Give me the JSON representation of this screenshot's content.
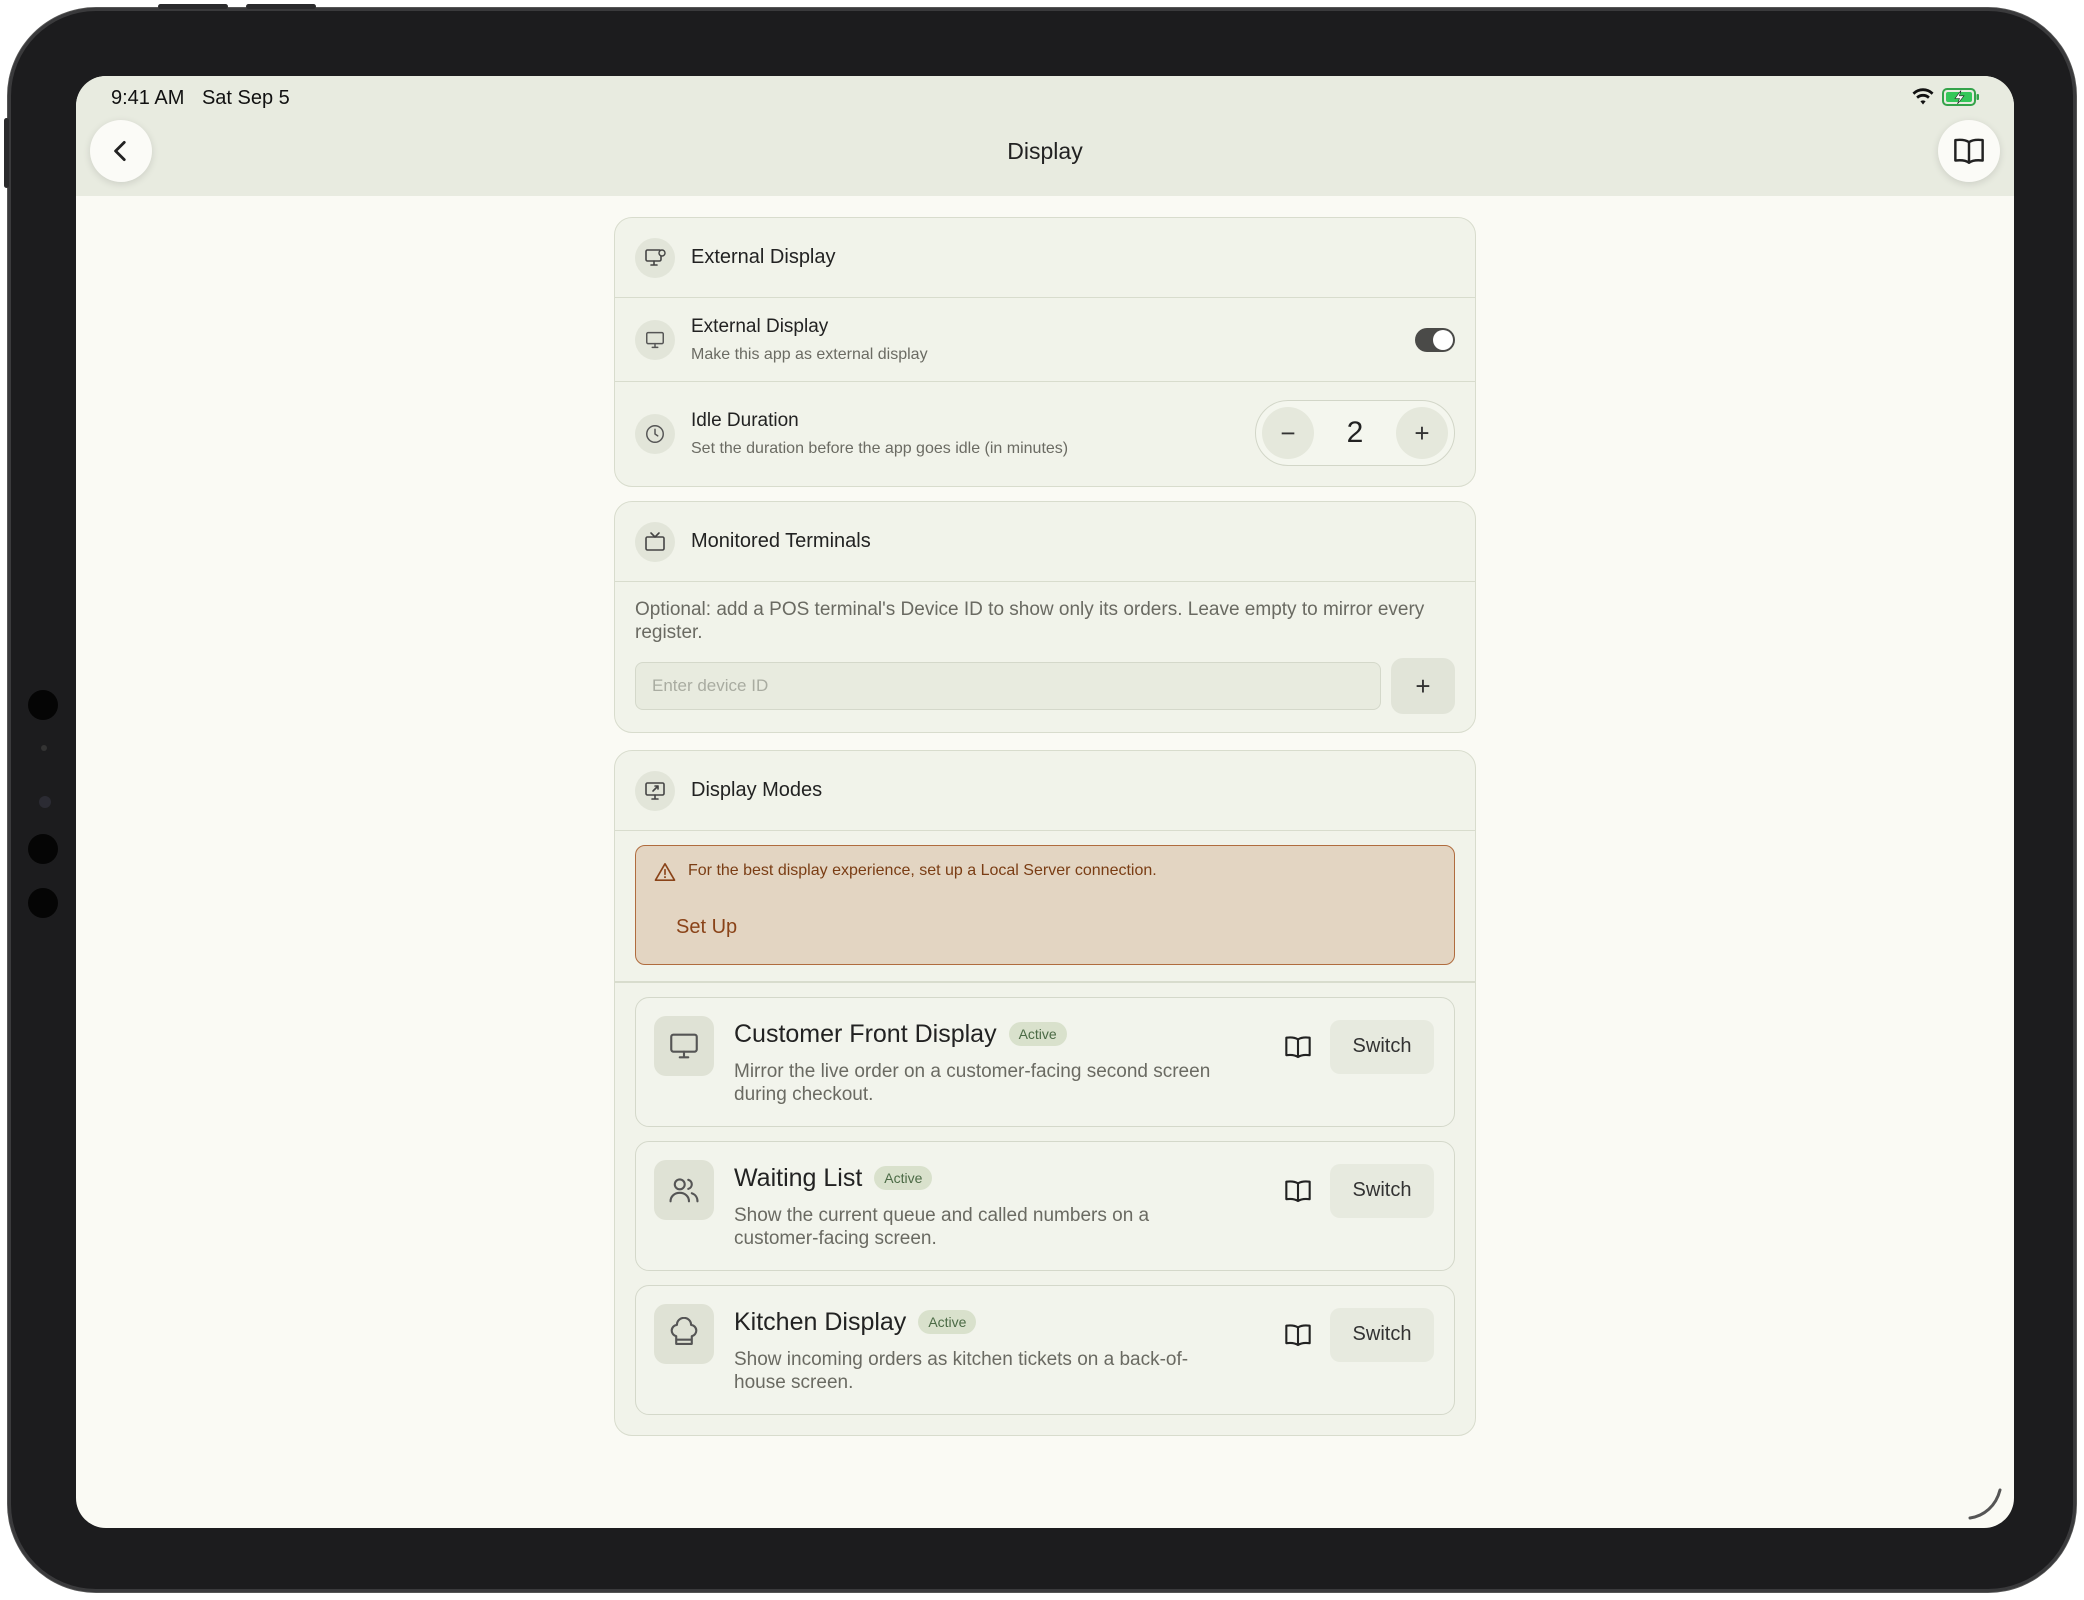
{
  "status": {
    "time": "9:41 AM",
    "date": "Sat Sep 5"
  },
  "header": {
    "title": "Display"
  },
  "external_display": {
    "section_title": "External Display",
    "toggle_row": {
      "title": "External Display",
      "subtitle": "Make this app as external display",
      "on": true
    },
    "idle_row": {
      "title": "Idle Duration",
      "subtitle": "Set the duration before the app goes idle (in minutes)",
      "value": "2",
      "minus": "−",
      "plus": "+"
    }
  },
  "monitored_terminals": {
    "section_title": "Monitored Terminals",
    "note": "Optional: add a POS terminal's Device ID to show only its orders. Leave empty to mirror every register.",
    "input_placeholder": "Enter device ID",
    "input_value": "",
    "add_label": "+"
  },
  "display_modes": {
    "section_title": "Display Modes",
    "warning": {
      "message": "For the best display experience, set up a Local Server connection.",
      "action": "Set Up"
    },
    "modes": [
      {
        "title": "Customer Front Display",
        "badge": "Active",
        "description": "Mirror the live order on a customer-facing second screen during checkout.",
        "action": "Switch",
        "icon": "monitor-icon"
      },
      {
        "title": "Waiting List",
        "badge": "Active",
        "description": "Show the current queue and called numbers on a customer-facing screen.",
        "action": "Switch",
        "icon": "users-icon"
      },
      {
        "title": "Kitchen Display",
        "badge": "Active",
        "description": "Show incoming orders as kitchen tickets on a back-of-house screen.",
        "action": "Switch",
        "icon": "chef-hat-icon"
      }
    ]
  },
  "colors": {
    "background": "#fafaf4",
    "topbar": "#e8ebe0",
    "warning_bg": "#e3d5c2",
    "warning_border": "#b06c3e",
    "badge_bg": "#d9e1cc"
  }
}
